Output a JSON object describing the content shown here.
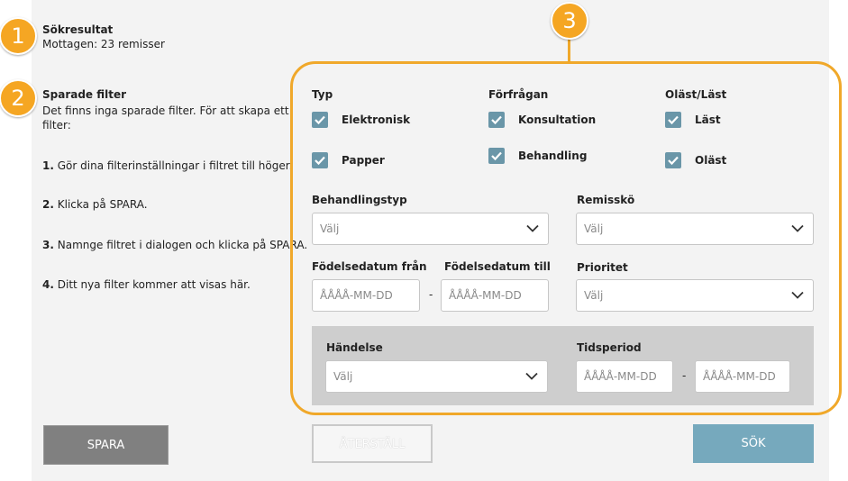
{
  "badges": [
    "1",
    "2",
    "3"
  ],
  "left": {
    "results_title": "Sökresultat",
    "results_count": "Mottagen: 23 remisser",
    "filters_title": "Sparade filter",
    "filters_desc_line1": "Det finns inga sparade filter. För att skapa ett",
    "filters_desc_line2": "filter:",
    "steps": [
      {
        "num": "1.",
        "text": "Gör dina filterinställningar i filtret till höger."
      },
      {
        "num": "2.",
        "text": "Klicka på SPARA."
      },
      {
        "num": "3.",
        "text": "Namnge filtret i dialogen och klicka på SPARA."
      },
      {
        "num": "4.",
        "text": "Ditt nya filter kommer att visas här."
      }
    ]
  },
  "filter": {
    "typ_label": "Typ",
    "typ_options": [
      {
        "label": "Elektronisk",
        "checked": true
      },
      {
        "label": "Papper",
        "checked": true
      }
    ],
    "forfragan_label": "Förfrågan",
    "forfragan_options": [
      {
        "label": "Konsultation",
        "checked": true
      },
      {
        "label": "Behandling",
        "checked": true
      }
    ],
    "last_label": "Oläst/Läst",
    "last_options": [
      {
        "label": "Läst",
        "checked": true
      },
      {
        "label": "Oläst",
        "checked": true
      }
    ],
    "behandlingstyp_label": "Behandlingstyp",
    "behandlingstyp_value": "Välj",
    "remissko_label": "Remisskö",
    "remissko_value": "Välj",
    "fodelse_fran_label": "Födelsedatum från",
    "fodelse_fran_placeholder": "ÅÅÅÅ-MM-DD",
    "fodelse_till_label": "Födelsedatum till",
    "fodelse_till_placeholder": "ÅÅÅÅ-MM-DD",
    "date_separator": "-",
    "prioritet_label": "Prioritet",
    "prioritet_value": "Välj",
    "handelse_label": "Händelse",
    "handelse_value": "Välj",
    "tidsperiod_label": "Tidsperiod",
    "tidsperiod_from_placeholder": "ÅÅÅÅ-MM-DD",
    "tidsperiod_to_placeholder": "ÅÅÅÅ-MM-DD"
  },
  "buttons": {
    "save": "SPARA",
    "reset": "ÅTERSTÄLL",
    "search": "SÖK"
  },
  "colors": {
    "badge": "#f5a623",
    "highlight": "#f0a82a",
    "checkbox": "#6a96a8",
    "save_button": "#808080",
    "search_button": "#76a9bd"
  }
}
